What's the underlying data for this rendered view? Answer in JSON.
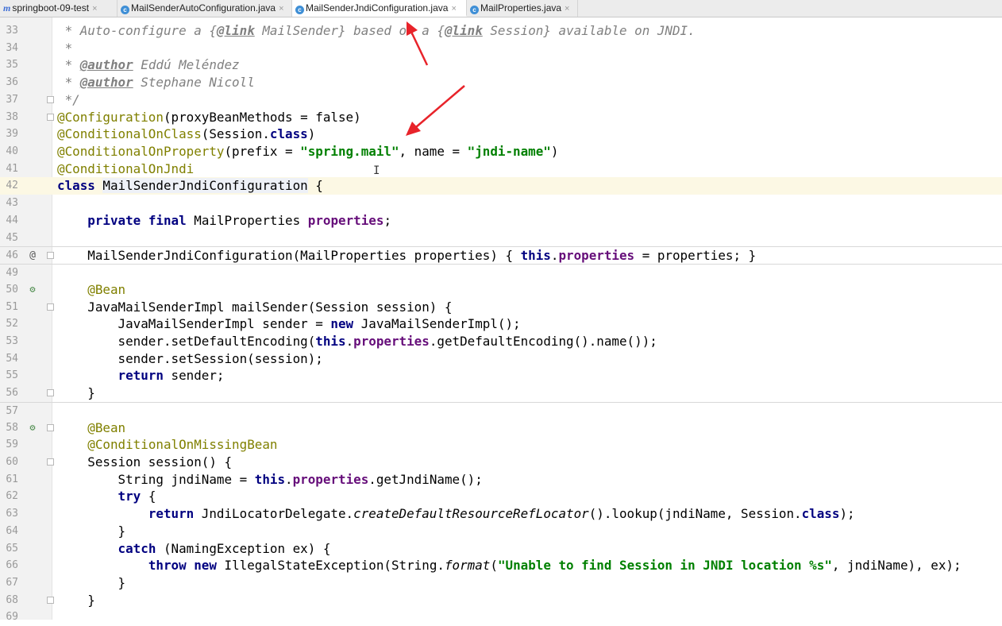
{
  "tabs": [
    {
      "label": "springboot-09-test",
      "icon": "module-icon",
      "active": false
    },
    {
      "label": "MailSenderAutoConfiguration.java",
      "icon": "class-icon",
      "active": false
    },
    {
      "label": "MailSenderJndiConfiguration.java",
      "icon": "class-icon",
      "active": true
    },
    {
      "label": "MailProperties.java",
      "icon": "class-icon",
      "active": false
    }
  ],
  "tab_close_glyph": "×",
  "editor": {
    "current_line": "42",
    "lines": [
      {
        "n": "33",
        "text": " * Auto-configure a {@link MailSender} based on a {@link Session} available on JNDI."
      },
      {
        "n": "34",
        "text": " *"
      },
      {
        "n": "35",
        "text": " * @author Eddú Meléndez"
      },
      {
        "n": "36",
        "text": " * @author Stephane Nicoll"
      },
      {
        "n": "37",
        "text": " */"
      },
      {
        "n": "38",
        "text": "@Configuration(proxyBeanMethods = false)"
      },
      {
        "n": "39",
        "text": "@ConditionalOnClass(Session.class)"
      },
      {
        "n": "40",
        "text": "@ConditionalOnProperty(prefix = \"spring.mail\", name = \"jndi-name\")"
      },
      {
        "n": "41",
        "text": "@ConditionalOnJndi"
      },
      {
        "n": "42",
        "text": "class MailSenderJndiConfiguration {"
      },
      {
        "n": "43",
        "text": ""
      },
      {
        "n": "44",
        "text": "    private final MailProperties properties;"
      },
      {
        "n": "45",
        "text": ""
      },
      {
        "n": "46",
        "text": "    MailSenderJndiConfiguration(MailProperties properties) { this.properties = properties; }"
      },
      {
        "n": "49",
        "text": ""
      },
      {
        "n": "50",
        "text": "    @Bean"
      },
      {
        "n": "51",
        "text": "    JavaMailSenderImpl mailSender(Session session) {"
      },
      {
        "n": "52",
        "text": "        JavaMailSenderImpl sender = new JavaMailSenderImpl();"
      },
      {
        "n": "53",
        "text": "        sender.setDefaultEncoding(this.properties.getDefaultEncoding().name());"
      },
      {
        "n": "54",
        "text": "        sender.setSession(session);"
      },
      {
        "n": "55",
        "text": "        return sender;"
      },
      {
        "n": "56",
        "text": "    }"
      },
      {
        "n": "57",
        "text": ""
      },
      {
        "n": "58",
        "text": "    @Bean"
      },
      {
        "n": "59",
        "text": "    @ConditionalOnMissingBean"
      },
      {
        "n": "60",
        "text": "    Session session() {"
      },
      {
        "n": "61",
        "text": "        String jndiName = this.properties.getJndiName();"
      },
      {
        "n": "62",
        "text": "        try {"
      },
      {
        "n": "63",
        "text": "            return JndiLocatorDelegate.createDefaultResourceRefLocator().lookup(jndiName, Session.class);"
      },
      {
        "n": "64",
        "text": "        }"
      },
      {
        "n": "65",
        "text": "        catch (NamingException ex) {"
      },
      {
        "n": "66",
        "text": "            throw new IllegalStateException(String.format(\"Unable to find Session in JNDI location %s\", jndiName), ex);"
      },
      {
        "n": "67",
        "text": "        }"
      },
      {
        "n": "68",
        "text": "    }"
      },
      {
        "n": "69",
        "text": ""
      }
    ]
  },
  "gutter_icons": {
    "46": {
      "glyph": "@",
      "name": "override-icon"
    },
    "50": {
      "glyph": "⚙",
      "name": "spring-bean-icon"
    },
    "58": {
      "glyph": "⚙",
      "name": "spring-bean-icon"
    }
  },
  "colors": {
    "keyword": "#000080",
    "annotation": "#808000",
    "string": "#008000",
    "field": "#660e7a",
    "comment": "#808080",
    "arrow": "#e8232a",
    "current_line_bg": "#fcf8e4"
  }
}
